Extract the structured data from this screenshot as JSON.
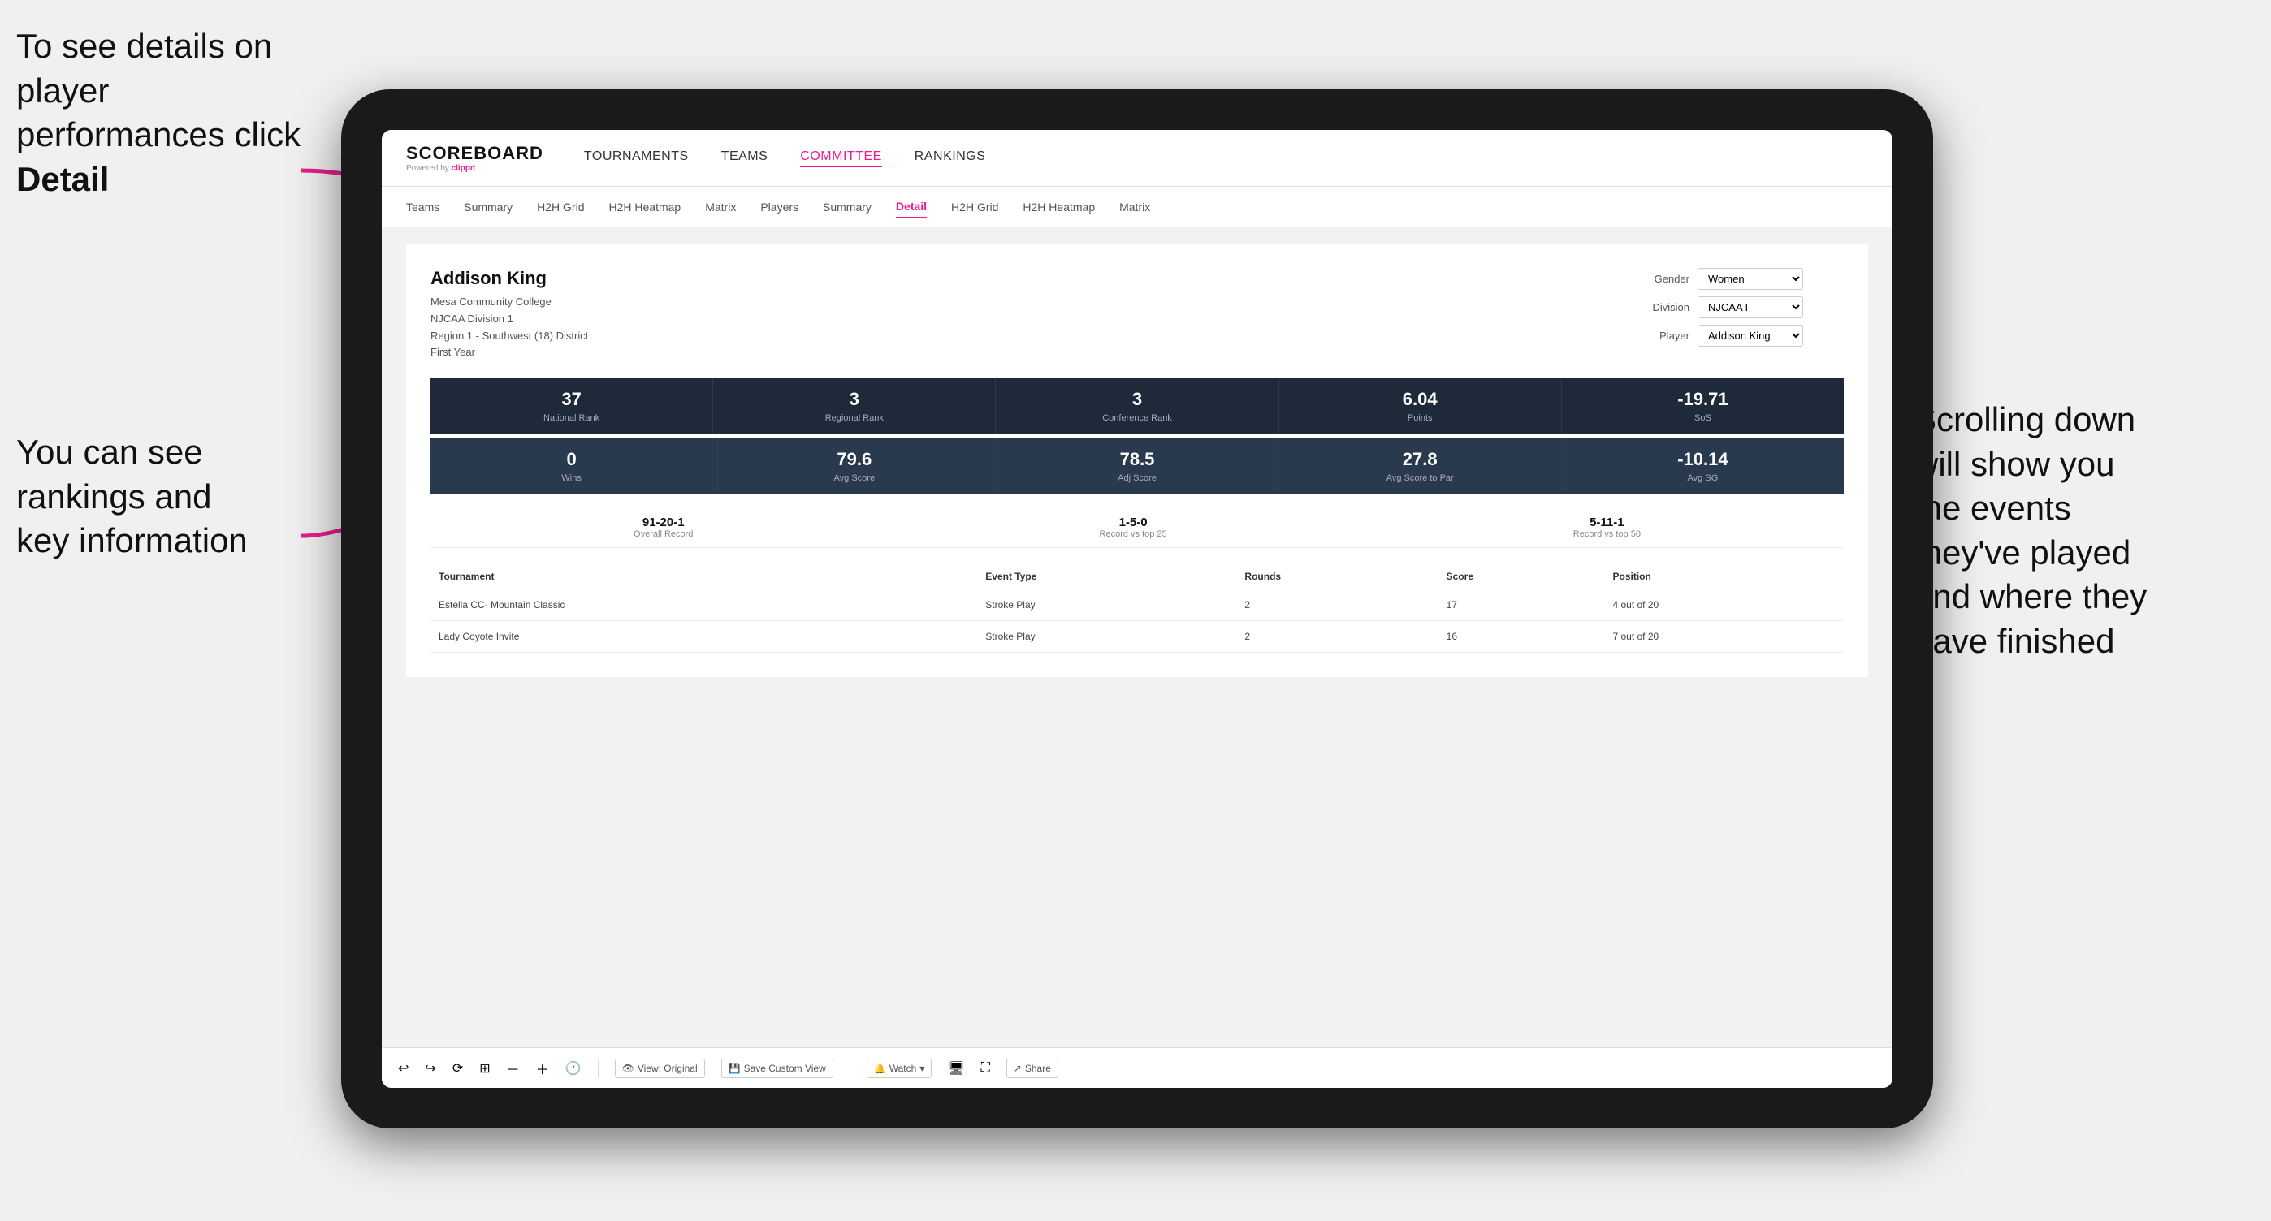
{
  "annotations": {
    "top_left": "To see details on player performances click ",
    "top_left_bold": "Detail",
    "bottom_left_line1": "You can see",
    "bottom_left_line2": "rankings and",
    "bottom_left_line3": "key information",
    "right_line1": "Scrolling down",
    "right_line2": "will show you",
    "right_line3": "the events",
    "right_line4": "they've played",
    "right_line5": "and where they",
    "right_line6": "have finished"
  },
  "nav": {
    "logo": "SCOREBOARD",
    "powered_by": "Powered by",
    "clippd": "clippd",
    "links": [
      "TOURNAMENTS",
      "TEAMS",
      "COMMITTEE",
      "RANKINGS"
    ],
    "active_link": "COMMITTEE"
  },
  "sub_nav": {
    "links": [
      "Teams",
      "Summary",
      "H2H Grid",
      "H2H Heatmap",
      "Matrix",
      "Players",
      "Summary",
      "Detail",
      "H2H Grid",
      "H2H Heatmap",
      "Matrix"
    ],
    "active": "Detail"
  },
  "player": {
    "name": "Addison King",
    "school": "Mesa Community College",
    "division": "NJCAA Division 1",
    "region": "Region 1 - Southwest (18) District",
    "year": "First Year"
  },
  "selectors": {
    "gender_label": "Gender",
    "gender_value": "Women",
    "division_label": "Division",
    "division_value": "NJCAA I",
    "player_label": "Player",
    "player_value": "Addison King"
  },
  "stats_row1": [
    {
      "value": "37",
      "label": "National Rank"
    },
    {
      "value": "3",
      "label": "Regional Rank"
    },
    {
      "value": "3",
      "label": "Conference Rank"
    },
    {
      "value": "6.04",
      "label": "Points"
    },
    {
      "value": "-19.71",
      "label": "SoS"
    }
  ],
  "stats_row2": [
    {
      "value": "0",
      "label": "Wins"
    },
    {
      "value": "79.6",
      "label": "Avg Score"
    },
    {
      "value": "78.5",
      "label": "Adj Score"
    },
    {
      "value": "27.8",
      "label": "Avg Score to Par"
    },
    {
      "value": "-10.14",
      "label": "Avg SG"
    }
  ],
  "records": [
    {
      "value": "91-20-1",
      "label": "Overall Record"
    },
    {
      "value": "1-5-0",
      "label": "Record vs top 25"
    },
    {
      "value": "5-11-1",
      "label": "Record vs top 50"
    }
  ],
  "table": {
    "headers": [
      "Tournament",
      "Event Type",
      "Rounds",
      "Score",
      "Position"
    ],
    "rows": [
      {
        "tournament": "Estella CC- Mountain Classic",
        "event_type": "Stroke Play",
        "rounds": "2",
        "score": "17",
        "position": "4 out of 20"
      },
      {
        "tournament": "Lady Coyote Invite",
        "event_type": "Stroke Play",
        "rounds": "2",
        "score": "16",
        "position": "7 out of 20"
      }
    ]
  },
  "toolbar": {
    "view_original": "View: Original",
    "save_custom": "Save Custom View",
    "watch": "Watch",
    "share": "Share"
  }
}
